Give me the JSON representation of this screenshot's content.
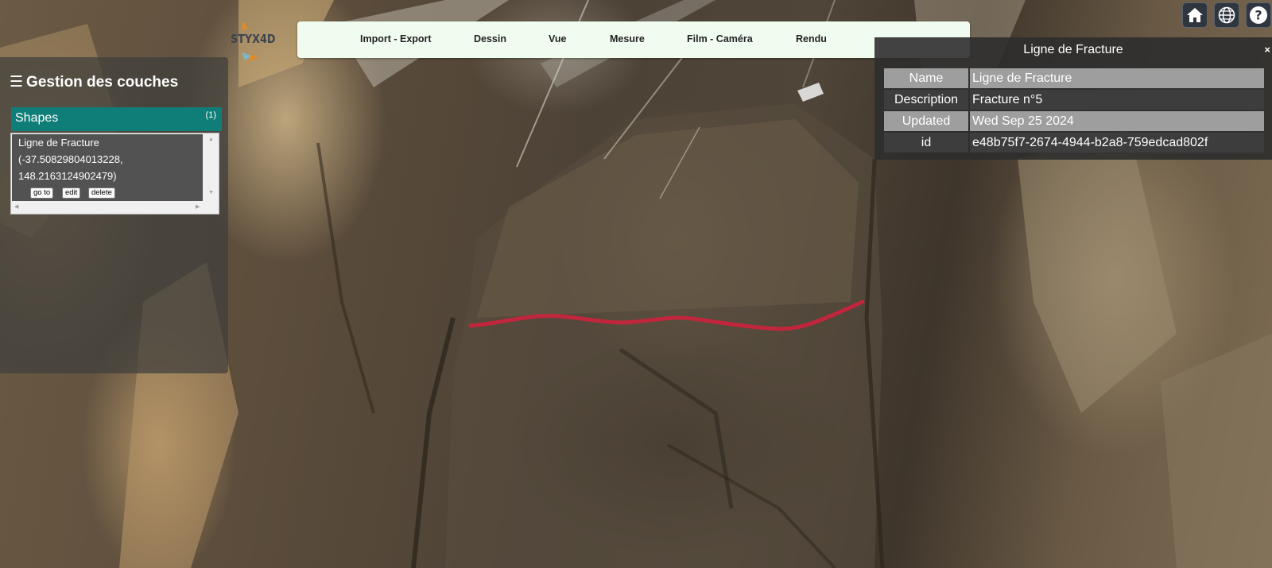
{
  "app": {
    "logo_text": "STYX4D"
  },
  "top_menu": {
    "items": [
      "Import - Export",
      "Dessin",
      "Vue",
      "Mesure",
      "Film - Caméra",
      "Rendu"
    ]
  },
  "top_right_icons": [
    "home-icon",
    "globe-icon",
    "help-icon"
  ],
  "layer_panel": {
    "title": "Gestion des couches",
    "shapes_label": "Shapes",
    "shapes_count": "(1)",
    "entries": [
      {
        "name": "Ligne de Fracture",
        "coord_line1": "(-37.50829804013228,",
        "coord_line2": "148.2163124902479)",
        "buttons": {
          "goto": "go to",
          "edit": "edit",
          "delete": "delete"
        }
      }
    ]
  },
  "feature_info": {
    "title": "Ligne de Fracture",
    "close": "×",
    "rows": [
      {
        "key": "Name",
        "value": "Ligne de Fracture"
      },
      {
        "key": "Description",
        "value": "Fracture n°5"
      },
      {
        "key": "Updated",
        "value": "Wed Sep 25 2024"
      },
      {
        "key": "id",
        "value": "e48b75f7-2674-4944-b2a8-759edcad802f"
      }
    ]
  },
  "colors": {
    "menu_bg": "#f1fcf1",
    "shapes_header": "#107e78",
    "fracture_line": "#c0263c",
    "panel_bg": "#3e3e3c"
  }
}
